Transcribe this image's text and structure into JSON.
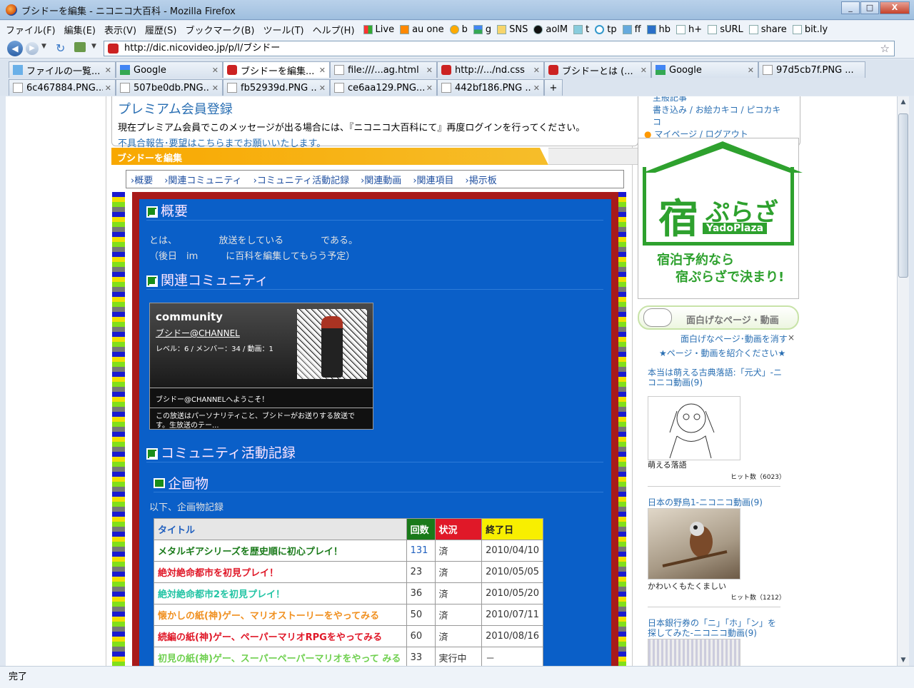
{
  "window": {
    "title": "ブシドーを編集 - ニコニコ大百科 - Mozilla Firefox",
    "btn_min": "_",
    "btn_max": "□",
    "btn_close": "X"
  },
  "menu": [
    "ファイル(F)",
    "編集(E)",
    "表示(V)",
    "履歴(S)",
    "ブックマーク(B)",
    "ツール(T)",
    "ヘルプ(H)"
  ],
  "bookmarks": [
    "Live",
    "au one",
    "b",
    "g",
    "SNS",
    "aolM",
    "t",
    "tp",
    "ff",
    "hb",
    "h+",
    "sURL",
    "share",
    "bit.ly"
  ],
  "url": "http://dic.nicovideo.jp/p/l/ブシドー",
  "tabs_row1": [
    {
      "label": "ファイルの一覧...",
      "active": false
    },
    {
      "label": "Google",
      "active": false
    },
    {
      "label": "ブシドーを編集...",
      "active": true
    },
    {
      "label": "file:///...ag.html",
      "active": false
    },
    {
      "label": "http://.../nd.css",
      "active": false
    },
    {
      "label": "ブシドーとは (...",
      "active": false
    },
    {
      "label": "Google",
      "active": false
    },
    {
      "label": "97d5cb7f.PNG ...",
      "active": false
    }
  ],
  "tabs_row2": [
    {
      "label": "6c467884.PNG..."
    },
    {
      "label": "507be0db.PNG..."
    },
    {
      "label": "fb52939d.PNG ..."
    },
    {
      "label": "ce6aa129.PNG..."
    },
    {
      "label": "442bf186.PNG ..."
    }
  ],
  "status": "完了",
  "premium": {
    "title": "プレミアム会員登録",
    "message": "現在プレミアム会員でこのメッセージが出る場合には、『ニコニコ大百科にて』再度ログインを行ってください。",
    "report": "不具合報告･要望はこちらまでお願いいたします。"
  },
  "edit_heading": "ブシドーを編集",
  "subnav": [
    "概要",
    "関連コミュニティ",
    "コミュニティ活動記録",
    "関連動画",
    "関連項目",
    "掲示板"
  ],
  "sections": {
    "overview": "概要",
    "overview_line1": "とは、　　　　　放送をしている　　　　である。",
    "overview_line2": "（後日　im　　　に百科を編集してもらう予定）",
    "community": "関連コミュニティ",
    "activity": "コミュニティ活動記録",
    "projects": "企画物",
    "projects_text": "以下、企画物記録"
  },
  "community_card": {
    "logo": "community",
    "name": "ブシドー@CHANNEL",
    "stats": "レベル：6 / メンバー：34 / 動画：1",
    "welcome": "ブシドー@CHANNELへようこそ！",
    "desc": "この放送はパーソナリティこと、ブシドーがお送りする放送です。生放送のテー..."
  },
  "table": {
    "headers": [
      "タイトル",
      "回数",
      "状況",
      "終了日"
    ],
    "header_colors": [
      "#e6e6e6",
      "#1a7a1a",
      "#e01828",
      "#f8ef00"
    ],
    "rows": [
      {
        "title": "メタルギアシリーズを歴史順に初心プレイ！",
        "color": "#1a7a1a",
        "count": "131",
        "status": "済",
        "date": "2010/04/10"
      },
      {
        "title": "絶対絶命都市を初見プレイ！",
        "color": "#e01828",
        "count": "23",
        "status": "済",
        "date": "2010/05/05"
      },
      {
        "title": "絶対絶命都市2を初見プレイ！",
        "color": "#22c4a4",
        "count": "36",
        "status": "済",
        "date": "2010/05/20"
      },
      {
        "title": "懐かしの紙(神)ゲー、マリオストーリーをやってみる",
        "color": "#f09020",
        "count": "50",
        "status": "済",
        "date": "2010/07/11"
      },
      {
        "title": "続編の紙(神)ゲー、ペーパーマリオRPGをやってみる",
        "color": "#e01828",
        "count": "60",
        "status": "済",
        "date": "2010/08/16"
      },
      {
        "title": "初見の紙(神)ゲー、スーパーペーパーマリオをやって みる",
        "color": "#70d050",
        "count": "33",
        "status": "実行中",
        "date": "－"
      }
    ]
  },
  "sidebar": {
    "top_links": [
      "主般記事",
      "書き込み",
      "お絵カキコ",
      "ピコカキコ",
      "マイページ",
      "ログアウト"
    ],
    "ad": {
      "logo_kanji": "宿",
      "logo_kana": "ぷらざ",
      "logo_en": "YadoPlaza",
      "tag1": "宿泊予約なら",
      "tag2": "宿ぷらざで決まり!"
    },
    "omoshiro_title": "面白げなページ・動画",
    "hide_link": "面白げなページ･動画を消す",
    "close_x": "×",
    "intro_link": "★ページ・動画を紹介ください★",
    "items": [
      {
        "title": "本当は萌える古典落語:「元犬」-ニコニコ動画(9)",
        "caption": "萌える落語",
        "hits": "ヒット数（6023）"
      },
      {
        "title": "日本の野鳥1-ニコニコ動画(9)",
        "caption": "かわいくもたくましい",
        "hits": "ヒット数（1212）"
      },
      {
        "title": "日本銀行券の「ニ」「ホ」「ン」を探してみた-ニコニコ動画(9)",
        "caption": "",
        "hits": ""
      }
    ]
  }
}
